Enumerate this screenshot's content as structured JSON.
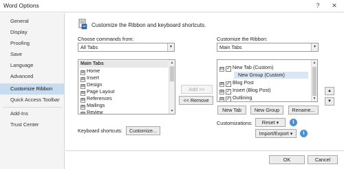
{
  "window": {
    "title": "Word Options",
    "help_glyph": "?",
    "close_glyph": "✕"
  },
  "sidebar": {
    "items": [
      {
        "label": "General"
      },
      {
        "label": "Display"
      },
      {
        "label": "Proofing"
      },
      {
        "label": "Save"
      },
      {
        "label": "Language"
      },
      {
        "label": "Advanced"
      },
      {
        "label": "Customize Ribbon"
      },
      {
        "label": "Quick Access Toolbar"
      },
      {
        "label": "Add-Ins"
      },
      {
        "label": "Trust Center"
      }
    ],
    "selected": "Customize Ribbon"
  },
  "header": {
    "text": "Customize the Ribbon and keyboard shortcuts."
  },
  "left": {
    "choose_label": "Choose commands from:",
    "choose_value": "All Tabs",
    "list_header": "Main Tabs",
    "items": [
      "Home",
      "Insert",
      "Design",
      "Page Layout",
      "References",
      "Mailings",
      "Review"
    ]
  },
  "right": {
    "customize_label": "Customize the Ribbon:",
    "customize_value": "Main Tabs",
    "items": [
      {
        "label": "New Tab (Custom)",
        "expander": "⊟",
        "checked": true
      },
      {
        "label": "New Group (Custom)",
        "expander": "",
        "checked": false
      },
      {
        "label": "Blog Post",
        "expander": "⊞",
        "checked": true
      },
      {
        "label": "Insert (Blog Post)",
        "expander": "⊞",
        "checked": true
      },
      {
        "label": "Outlining",
        "expander": "⊞",
        "checked": true
      }
    ]
  },
  "buttons": {
    "add": "Add >>",
    "remove": "<< Remove",
    "new_tab": "New Tab",
    "new_group": "New Group",
    "rename": "Rename...",
    "customize": "Customize...",
    "reset": "Reset",
    "import_export": "Import/Export",
    "ok": "OK",
    "cancel": "Cancel",
    "move_up": "▲",
    "move_down": "▼"
  },
  "keyboard_shortcuts_label": "Keyboard shortcuts:",
  "customizations_label": "Customizations:",
  "glyphs": {
    "expand": "⊞",
    "dropdown": "▾",
    "check": "✓",
    "info": "ℹ"
  },
  "colors": {
    "selected_nav": "#c8dcef",
    "item_highlight": "#d9e7f4"
  }
}
